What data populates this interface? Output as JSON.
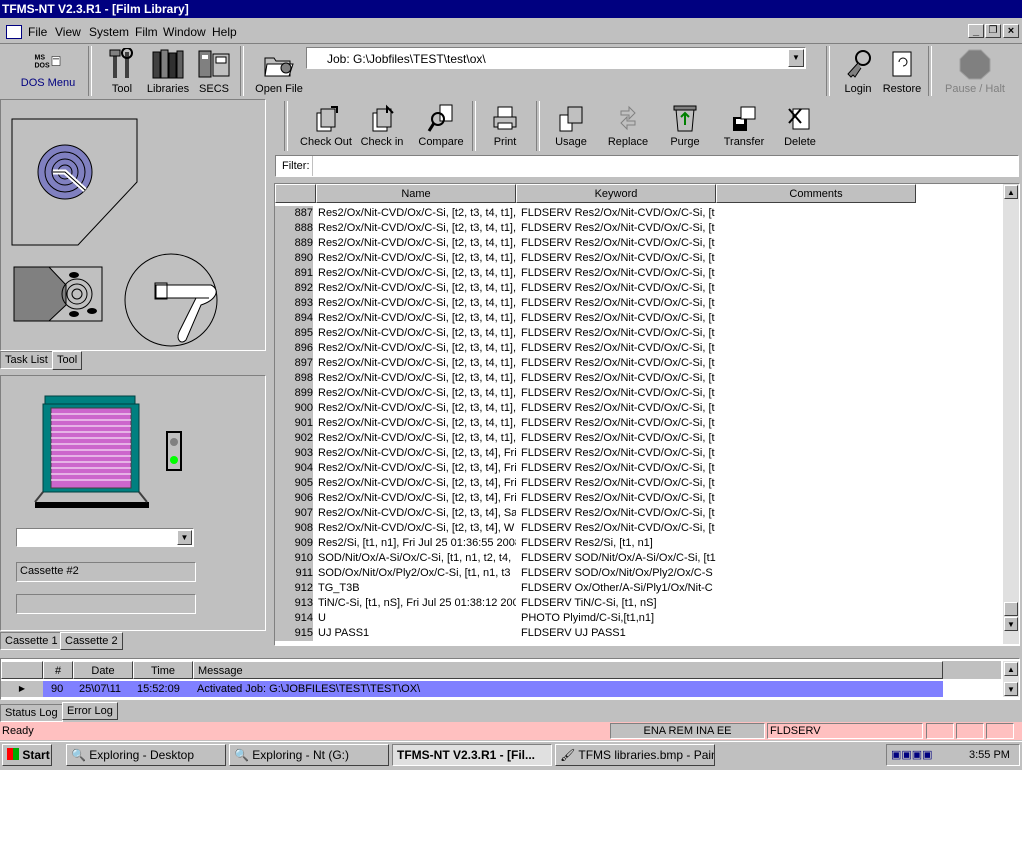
{
  "window": {
    "title": "TFMS-NT V2.3.R1 - [Film Library]"
  },
  "menu": [
    "File",
    "View",
    "System",
    "Film",
    "Window",
    "Help"
  ],
  "toolbar": {
    "dos_menu": "DOS Menu",
    "tool": "Tool",
    "libraries": "Libraries",
    "secs": "SECS",
    "open_file": "Open File",
    "job_value": "Job: G:\\Jobfiles\\TEST\\test\\ox\\",
    "login": "Login",
    "restore": "Restore",
    "pause_halt": "Pause / Halt"
  },
  "film_toolbar": [
    "Check Out",
    "Check in",
    "Compare",
    "Print",
    "Usage",
    "Replace",
    "Purge",
    "Transfer",
    "Delete"
  ],
  "filter_label": "Filter:",
  "grid": {
    "headers": {
      "name": "Name",
      "keyword": "Keyword",
      "comments": "Comments"
    },
    "rows": [
      {
        "n": "887",
        "name": "Res2/Ox/Nit-CVD/Ox/C-Si, [t2, t3, t4, t1],",
        "kw": "FLDSERV Res2/Ox/Nit-CVD/Ox/C-Si, [t"
      },
      {
        "n": "888",
        "name": "Res2/Ox/Nit-CVD/Ox/C-Si, [t2, t3, t4, t1],",
        "kw": "FLDSERV Res2/Ox/Nit-CVD/Ox/C-Si, [t"
      },
      {
        "n": "889",
        "name": "Res2/Ox/Nit-CVD/Ox/C-Si, [t2, t3, t4, t1],",
        "kw": "FLDSERV Res2/Ox/Nit-CVD/Ox/C-Si, [t"
      },
      {
        "n": "890",
        "name": "Res2/Ox/Nit-CVD/Ox/C-Si, [t2, t3, t4, t1],",
        "kw": "FLDSERV Res2/Ox/Nit-CVD/Ox/C-Si, [t"
      },
      {
        "n": "891",
        "name": "Res2/Ox/Nit-CVD/Ox/C-Si, [t2, t3, t4, t1],",
        "kw": "FLDSERV Res2/Ox/Nit-CVD/Ox/C-Si, [t"
      },
      {
        "n": "892",
        "name": "Res2/Ox/Nit-CVD/Ox/C-Si, [t2, t3, t4, t1],",
        "kw": "FLDSERV Res2/Ox/Nit-CVD/Ox/C-Si, [t"
      },
      {
        "n": "893",
        "name": "Res2/Ox/Nit-CVD/Ox/C-Si, [t2, t3, t4, t1],",
        "kw": "FLDSERV Res2/Ox/Nit-CVD/Ox/C-Si, [t"
      },
      {
        "n": "894",
        "name": "Res2/Ox/Nit-CVD/Ox/C-Si, [t2, t3, t4, t1],",
        "kw": "FLDSERV Res2/Ox/Nit-CVD/Ox/C-Si, [t"
      },
      {
        "n": "895",
        "name": "Res2/Ox/Nit-CVD/Ox/C-Si, [t2, t3, t4, t1],",
        "kw": "FLDSERV Res2/Ox/Nit-CVD/Ox/C-Si, [t"
      },
      {
        "n": "896",
        "name": "Res2/Ox/Nit-CVD/Ox/C-Si, [t2, t3, t4, t1],",
        "kw": "FLDSERV Res2/Ox/Nit-CVD/Ox/C-Si, [t"
      },
      {
        "n": "897",
        "name": "Res2/Ox/Nit-CVD/Ox/C-Si, [t2, t3, t4, t1],",
        "kw": "FLDSERV Res2/Ox/Nit-CVD/Ox/C-Si, [t"
      },
      {
        "n": "898",
        "name": "Res2/Ox/Nit-CVD/Ox/C-Si, [t2, t3, t4, t1],",
        "kw": "FLDSERV Res2/Ox/Nit-CVD/Ox/C-Si, [t"
      },
      {
        "n": "899",
        "name": "Res2/Ox/Nit-CVD/Ox/C-Si, [t2, t3, t4, t1],",
        "kw": "FLDSERV Res2/Ox/Nit-CVD/Ox/C-Si, [t"
      },
      {
        "n": "900",
        "name": "Res2/Ox/Nit-CVD/Ox/C-Si, [t2, t3, t4, t1],",
        "kw": "FLDSERV Res2/Ox/Nit-CVD/Ox/C-Si, [t"
      },
      {
        "n": "901",
        "name": "Res2/Ox/Nit-CVD/Ox/C-Si, [t2, t3, t4, t1],",
        "kw": "FLDSERV Res2/Ox/Nit-CVD/Ox/C-Si, [t"
      },
      {
        "n": "902",
        "name": "Res2/Ox/Nit-CVD/Ox/C-Si, [t2, t3, t4, t1],",
        "kw": "FLDSERV Res2/Ox/Nit-CVD/Ox/C-Si, [t"
      },
      {
        "n": "903",
        "name": "Res2/Ox/Nit-CVD/Ox/C-Si, [t2, t3, t4], Fri",
        "kw": "FLDSERV Res2/Ox/Nit-CVD/Ox/C-Si, [t"
      },
      {
        "n": "904",
        "name": "Res2/Ox/Nit-CVD/Ox/C-Si, [t2, t3, t4], Fri",
        "kw": "FLDSERV Res2/Ox/Nit-CVD/Ox/C-Si, [t"
      },
      {
        "n": "905",
        "name": "Res2/Ox/Nit-CVD/Ox/C-Si, [t2, t3, t4], Fri",
        "kw": "FLDSERV Res2/Ox/Nit-CVD/Ox/C-Si, [t"
      },
      {
        "n": "906",
        "name": "Res2/Ox/Nit-CVD/Ox/C-Si, [t2, t3, t4], Fri",
        "kw": "FLDSERV Res2/Ox/Nit-CVD/Ox/C-Si, [t"
      },
      {
        "n": "907",
        "name": "Res2/Ox/Nit-CVD/Ox/C-Si, [t2, t3, t4], Sa",
        "kw": "FLDSERV Res2/Ox/Nit-CVD/Ox/C-Si, [t"
      },
      {
        "n": "908",
        "name": "Res2/Ox/Nit-CVD/Ox/C-Si, [t2, t3, t4], W",
        "kw": "FLDSERV Res2/Ox/Nit-CVD/Ox/C-Si, [t"
      },
      {
        "n": "909",
        "name": "Res2/Si, [t1, n1], Fri Jul 25 01:36:55 2008",
        "kw": "FLDSERV Res2/Si, [t1, n1]"
      },
      {
        "n": "910",
        "name": "SOD/Nit/Ox/A-Si/Ox/C-Si, [t1, n1, t2, t4,",
        "kw": "FLDSERV SOD/Nit/Ox/A-Si/Ox/C-Si, [t1"
      },
      {
        "n": "911",
        "name": "SOD/Ox/Nit/Ox/Ply2/Ox/C-Si, [t1, n1, t3",
        "kw": "FLDSERV SOD/Ox/Nit/Ox/Ply2/Ox/C-S"
      },
      {
        "n": "912",
        "name": "TG_T3B",
        "kw": "FLDSERV Ox/Other/A-Si/Ply1/Ox/Nit-C"
      },
      {
        "n": "913",
        "name": "TiN/C-Si, [t1, nS], Fri Jul 25 01:38:12 200",
        "kw": "FLDSERV TiN/C-Si, [t1, nS]"
      },
      {
        "n": "914",
        "name": "U",
        "kw": "PHOTO Plyimd/C-Si,[t1,n1]"
      },
      {
        "n": "915",
        "name": "UJ PASS1",
        "kw": "FLDSERV UJ PASS1"
      }
    ]
  },
  "left_panel": {
    "tabs_top": [
      "Task List",
      "Tool"
    ],
    "cassette_value": "Cassette #2",
    "tabs_bottom": [
      "Cassette 1",
      "Cassette 2"
    ]
  },
  "log": {
    "headers": {
      "num": "#",
      "date": "Date",
      "time": "Time",
      "message": "Message"
    },
    "row": {
      "num": "90",
      "date": "25\\07\\11",
      "time": "15:52:09",
      "message": "Activated Job: G:\\JOBFILES\\TEST\\TEST\\OX\\"
    },
    "tabs": [
      "Status Log",
      "Error Log"
    ]
  },
  "status": {
    "ready": "Ready",
    "mode": "ENA REM INA EE",
    "server": "FLDSERV"
  },
  "taskbar": {
    "start": "Start",
    "items": [
      "Exploring - Desktop",
      "Exploring - Nt (G:)",
      "TFMS-NT V2.3.R1 - [Fil...",
      "TFMS libraries.bmp - Paint"
    ],
    "clock": "3:55 PM"
  },
  "colors": {
    "title_bar": "#000080",
    "selection": "#8080ff",
    "status_pink": "#ffc0c0",
    "face": "#c0c0c0",
    "cassette": "#cc66cc",
    "teal": "#008080"
  }
}
